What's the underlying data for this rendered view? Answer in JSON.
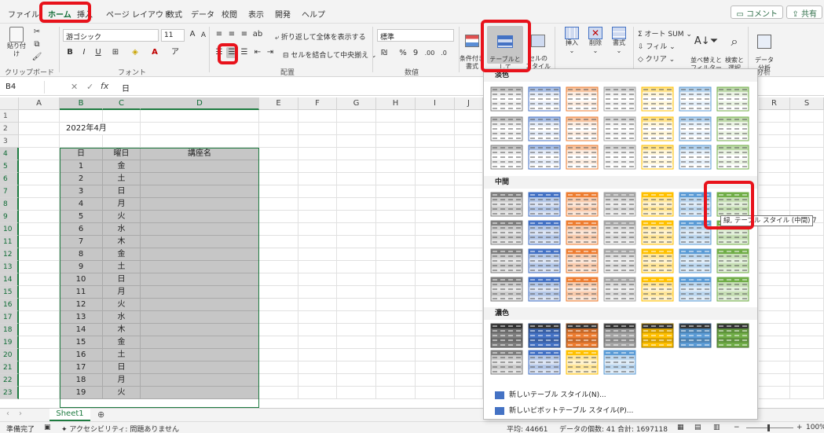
{
  "tabs": [
    "ファイル",
    "ホーム",
    "挿入",
    "ページ レイアウト",
    "数式",
    "データ",
    "校閲",
    "表示",
    "開発",
    "ヘルプ"
  ],
  "active_tab": "ホーム",
  "header_buttons": {
    "comment": "コメント",
    "share": "共有"
  },
  "ribbon": {
    "clipboard": {
      "paste": "貼り付け",
      "label": "クリップボード"
    },
    "font": {
      "name": "游ゴシック",
      "size": "11",
      "label": "フォント",
      "bold": "B",
      "italic": "I",
      "underline": "U"
    },
    "alignment": {
      "wrap": "折り返して全体を表示する",
      "merge": "セルを結合して中央揃え",
      "label": "配置"
    },
    "number": {
      "format": "標準",
      "percent": "%",
      "comma": "9",
      "label": "数値"
    },
    "styles": {
      "conditional": "条件付き\n書式",
      "as_table": "テーブルとして\n書式設定",
      "cell_styles": "セルの\nスタイル"
    },
    "cells": {
      "insert": "挿入",
      "delete": "削除",
      "format": "書式"
    },
    "editing": {
      "autosum": "Σ オート SUM",
      "fill": "フィル",
      "clear": "クリア",
      "sort": "並べ替えと\nフィルター",
      "find": "検索と\n選択"
    },
    "analysis": {
      "data": "データ\n分析",
      "label": "分析"
    }
  },
  "formula_bar": {
    "cell_ref": "B4",
    "fx": "fx",
    "value": "日"
  },
  "columns": [
    "A",
    "B",
    "C",
    "D",
    "E",
    "F",
    "G",
    "H",
    "I",
    "J",
    "R",
    "S"
  ],
  "rows": [
    "1",
    "2",
    "3",
    "4",
    "5",
    "6",
    "7",
    "8",
    "9",
    "10",
    "11",
    "12",
    "13",
    "14",
    "15",
    "16",
    "17",
    "18",
    "19",
    "20",
    "21",
    "22",
    "23"
  ],
  "sheet": {
    "date_title": "2022年4月",
    "headers": [
      "日",
      "曜日",
      "講座名"
    ],
    "day_nums": [
      "1",
      "2",
      "3",
      "4",
      "5",
      "6",
      "7",
      "8",
      "9",
      "10",
      "11",
      "12",
      "13",
      "14",
      "15",
      "16",
      "17",
      "18",
      "19"
    ],
    "weekdays": [
      "金",
      "土",
      "日",
      "月",
      "火",
      "水",
      "木",
      "金",
      "土",
      "日",
      "月",
      "火",
      "水",
      "木",
      "金",
      "土",
      "日",
      "月",
      "火"
    ]
  },
  "panel": {
    "section_light": "淡色",
    "section_medium": "中間",
    "section_dark": "濃色",
    "new_table_style": "新しいテーブル スタイル(N)...",
    "new_pivot_style": "新しいピボットテーブル スタイル(P)...",
    "tooltip": "緑, テーブル スタイル (中間) 7",
    "colors": [
      "#7f7f7f",
      "#4472c4",
      "#ed7d31",
      "#a5a5a5",
      "#ffc000",
      "#5b9bd5",
      "#70ad47"
    ]
  },
  "sheet_tabs": [
    "Sheet1"
  ],
  "add_sheet": "⊕",
  "status": {
    "ready": "準備完了",
    "accessibility": "アクセシビリティ: 問題ありません",
    "average": "平均: 44661",
    "count": "データの個数: 41",
    "sum": "合計: 1697118",
    "zoom": "100%"
  }
}
